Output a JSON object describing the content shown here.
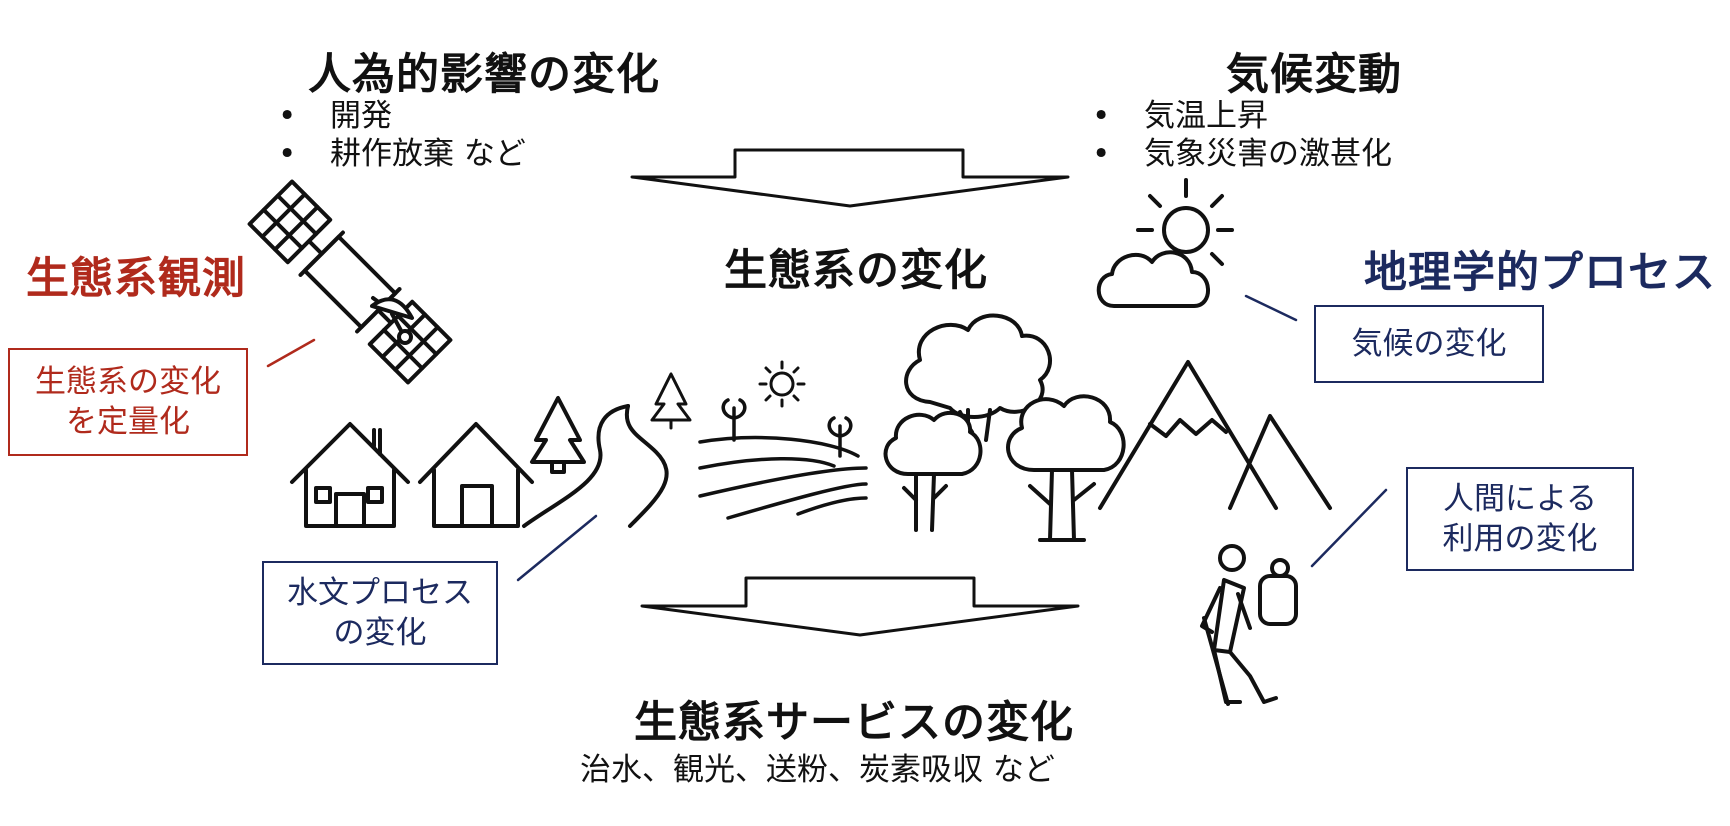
{
  "human_impact": {
    "title": "人為的影響の変化",
    "items": [
      "開発",
      "耕作放棄 など"
    ]
  },
  "climate_change": {
    "title": "気候変動",
    "items": [
      "気温上昇",
      "気象災害の激甚化"
    ]
  },
  "ecosystem_change": {
    "title": "生態系の変化"
  },
  "ecosystem_observation": {
    "title": "生態系観測",
    "box_lines": [
      "生態系の変化",
      "を定量化"
    ]
  },
  "geographic_process": {
    "title": "地理学的プロセス",
    "climate_box": "気候の変化",
    "human_use_box_lines": [
      "人間による",
      "利用の変化"
    ]
  },
  "hydrology_box_lines": [
    "水文プロセス",
    "の変化"
  ],
  "ecosystem_services": {
    "title": "生態系サービスの変化",
    "examples": "治水、観光、送粉、炭素吸収 など"
  },
  "colors": {
    "red": "#b02a1c",
    "navy": "#1c2a5f",
    "ink": "#111111"
  },
  "icons": [
    "satellite-icon",
    "sun-cloud-icon",
    "house-icon",
    "pine-tree-icon",
    "river-icon",
    "farm-field-icon",
    "sun-icon",
    "deciduous-tree-icon",
    "mountain-icon",
    "hiker-icon",
    "arrow-down-icon"
  ]
}
